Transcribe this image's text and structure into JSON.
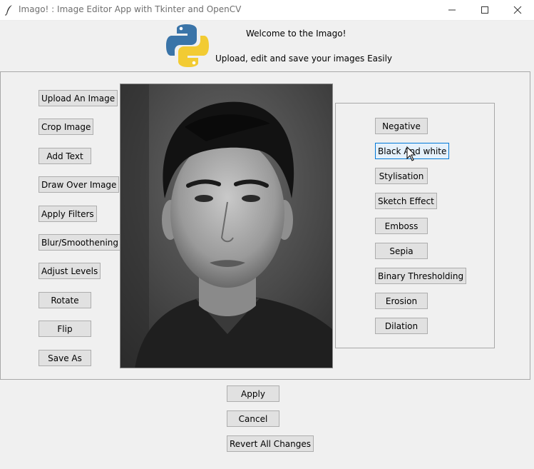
{
  "window": {
    "title": "Imago! : Image Editor App with Tkinter and OpenCV",
    "controls": [
      "minimize",
      "maximize",
      "close"
    ],
    "app_icon": "feather-icon"
  },
  "header": {
    "logo": "python-logo",
    "welcome": "Welcome to the Imago!",
    "subtitle": "Upload, edit and save your images Easily"
  },
  "toolbar": {
    "buttons": [
      "Upload An Image",
      "Crop Image",
      "Add Text",
      "Draw Over Image",
      "Apply Filters",
      "Blur/Smoothening",
      "Adjust Levels",
      "Rotate",
      "Flip",
      "Save As"
    ]
  },
  "filters": {
    "buttons": [
      "Negative",
      "Black And white",
      "Stylisation",
      "Sketch Effect",
      "Emboss",
      "Sepia",
      "Binary Thresholding",
      "Erosion",
      "Dilation"
    ],
    "focused": "Black And white"
  },
  "actions": {
    "apply": "Apply",
    "cancel": "Cancel",
    "revert": "Revert All Changes"
  },
  "canvas": {
    "image": "portrait image"
  }
}
